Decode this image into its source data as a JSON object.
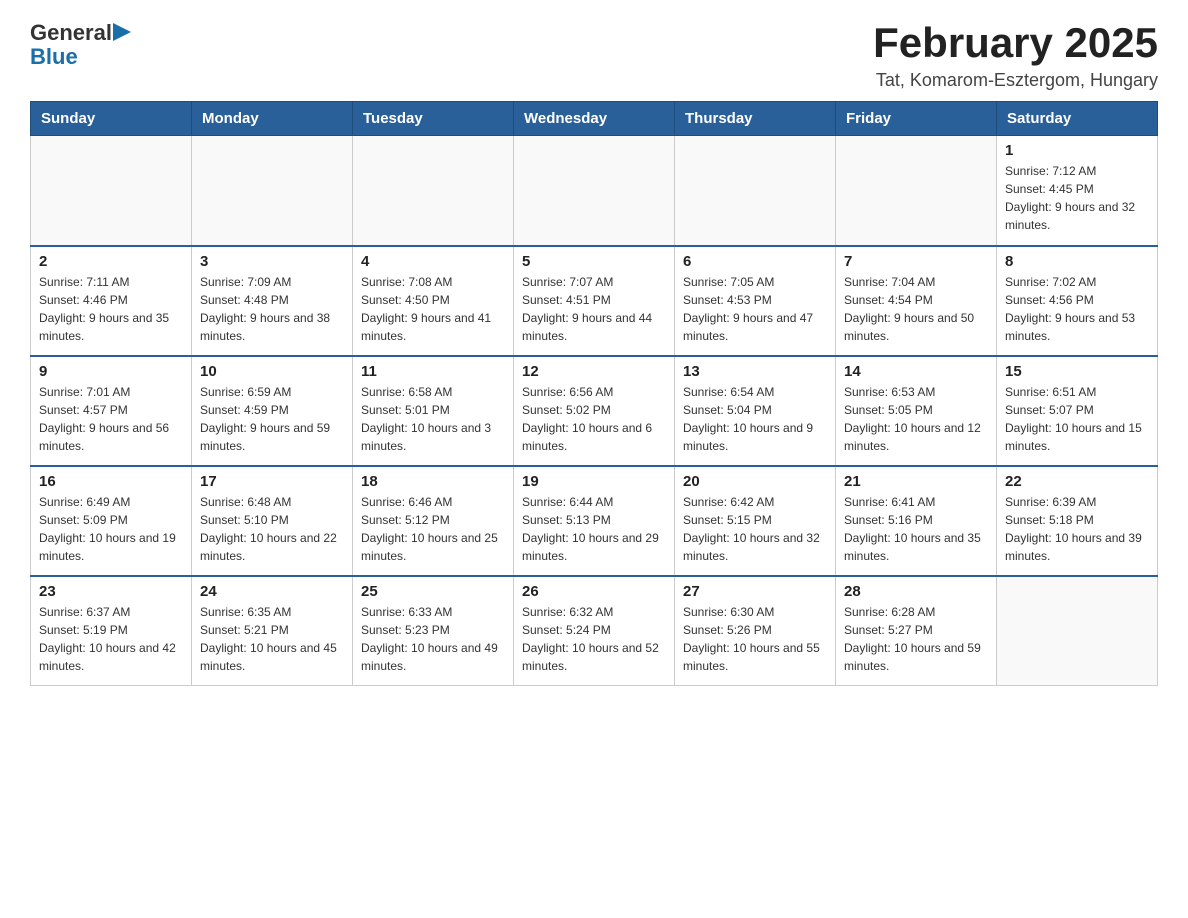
{
  "logo": {
    "general": "General",
    "blue": "Blue",
    "arrow": "▶"
  },
  "title": "February 2025",
  "subtitle": "Tat, Komarom-Esztergom, Hungary",
  "days_header": [
    "Sunday",
    "Monday",
    "Tuesday",
    "Wednesday",
    "Thursday",
    "Friday",
    "Saturday"
  ],
  "weeks": [
    [
      {
        "day": "",
        "info": ""
      },
      {
        "day": "",
        "info": ""
      },
      {
        "day": "",
        "info": ""
      },
      {
        "day": "",
        "info": ""
      },
      {
        "day": "",
        "info": ""
      },
      {
        "day": "",
        "info": ""
      },
      {
        "day": "1",
        "info": "Sunrise: 7:12 AM\nSunset: 4:45 PM\nDaylight: 9 hours and 32 minutes."
      }
    ],
    [
      {
        "day": "2",
        "info": "Sunrise: 7:11 AM\nSunset: 4:46 PM\nDaylight: 9 hours and 35 minutes."
      },
      {
        "day": "3",
        "info": "Sunrise: 7:09 AM\nSunset: 4:48 PM\nDaylight: 9 hours and 38 minutes."
      },
      {
        "day": "4",
        "info": "Sunrise: 7:08 AM\nSunset: 4:50 PM\nDaylight: 9 hours and 41 minutes."
      },
      {
        "day": "5",
        "info": "Sunrise: 7:07 AM\nSunset: 4:51 PM\nDaylight: 9 hours and 44 minutes."
      },
      {
        "day": "6",
        "info": "Sunrise: 7:05 AM\nSunset: 4:53 PM\nDaylight: 9 hours and 47 minutes."
      },
      {
        "day": "7",
        "info": "Sunrise: 7:04 AM\nSunset: 4:54 PM\nDaylight: 9 hours and 50 minutes."
      },
      {
        "day": "8",
        "info": "Sunrise: 7:02 AM\nSunset: 4:56 PM\nDaylight: 9 hours and 53 minutes."
      }
    ],
    [
      {
        "day": "9",
        "info": "Sunrise: 7:01 AM\nSunset: 4:57 PM\nDaylight: 9 hours and 56 minutes."
      },
      {
        "day": "10",
        "info": "Sunrise: 6:59 AM\nSunset: 4:59 PM\nDaylight: 9 hours and 59 minutes."
      },
      {
        "day": "11",
        "info": "Sunrise: 6:58 AM\nSunset: 5:01 PM\nDaylight: 10 hours and 3 minutes."
      },
      {
        "day": "12",
        "info": "Sunrise: 6:56 AM\nSunset: 5:02 PM\nDaylight: 10 hours and 6 minutes."
      },
      {
        "day": "13",
        "info": "Sunrise: 6:54 AM\nSunset: 5:04 PM\nDaylight: 10 hours and 9 minutes."
      },
      {
        "day": "14",
        "info": "Sunrise: 6:53 AM\nSunset: 5:05 PM\nDaylight: 10 hours and 12 minutes."
      },
      {
        "day": "15",
        "info": "Sunrise: 6:51 AM\nSunset: 5:07 PM\nDaylight: 10 hours and 15 minutes."
      }
    ],
    [
      {
        "day": "16",
        "info": "Sunrise: 6:49 AM\nSunset: 5:09 PM\nDaylight: 10 hours and 19 minutes."
      },
      {
        "day": "17",
        "info": "Sunrise: 6:48 AM\nSunset: 5:10 PM\nDaylight: 10 hours and 22 minutes."
      },
      {
        "day": "18",
        "info": "Sunrise: 6:46 AM\nSunset: 5:12 PM\nDaylight: 10 hours and 25 minutes."
      },
      {
        "day": "19",
        "info": "Sunrise: 6:44 AM\nSunset: 5:13 PM\nDaylight: 10 hours and 29 minutes."
      },
      {
        "day": "20",
        "info": "Sunrise: 6:42 AM\nSunset: 5:15 PM\nDaylight: 10 hours and 32 minutes."
      },
      {
        "day": "21",
        "info": "Sunrise: 6:41 AM\nSunset: 5:16 PM\nDaylight: 10 hours and 35 minutes."
      },
      {
        "day": "22",
        "info": "Sunrise: 6:39 AM\nSunset: 5:18 PM\nDaylight: 10 hours and 39 minutes."
      }
    ],
    [
      {
        "day": "23",
        "info": "Sunrise: 6:37 AM\nSunset: 5:19 PM\nDaylight: 10 hours and 42 minutes."
      },
      {
        "day": "24",
        "info": "Sunrise: 6:35 AM\nSunset: 5:21 PM\nDaylight: 10 hours and 45 minutes."
      },
      {
        "day": "25",
        "info": "Sunrise: 6:33 AM\nSunset: 5:23 PM\nDaylight: 10 hours and 49 minutes."
      },
      {
        "day": "26",
        "info": "Sunrise: 6:32 AM\nSunset: 5:24 PM\nDaylight: 10 hours and 52 minutes."
      },
      {
        "day": "27",
        "info": "Sunrise: 6:30 AM\nSunset: 5:26 PM\nDaylight: 10 hours and 55 minutes."
      },
      {
        "day": "28",
        "info": "Sunrise: 6:28 AM\nSunset: 5:27 PM\nDaylight: 10 hours and 59 minutes."
      },
      {
        "day": "",
        "info": ""
      }
    ]
  ]
}
